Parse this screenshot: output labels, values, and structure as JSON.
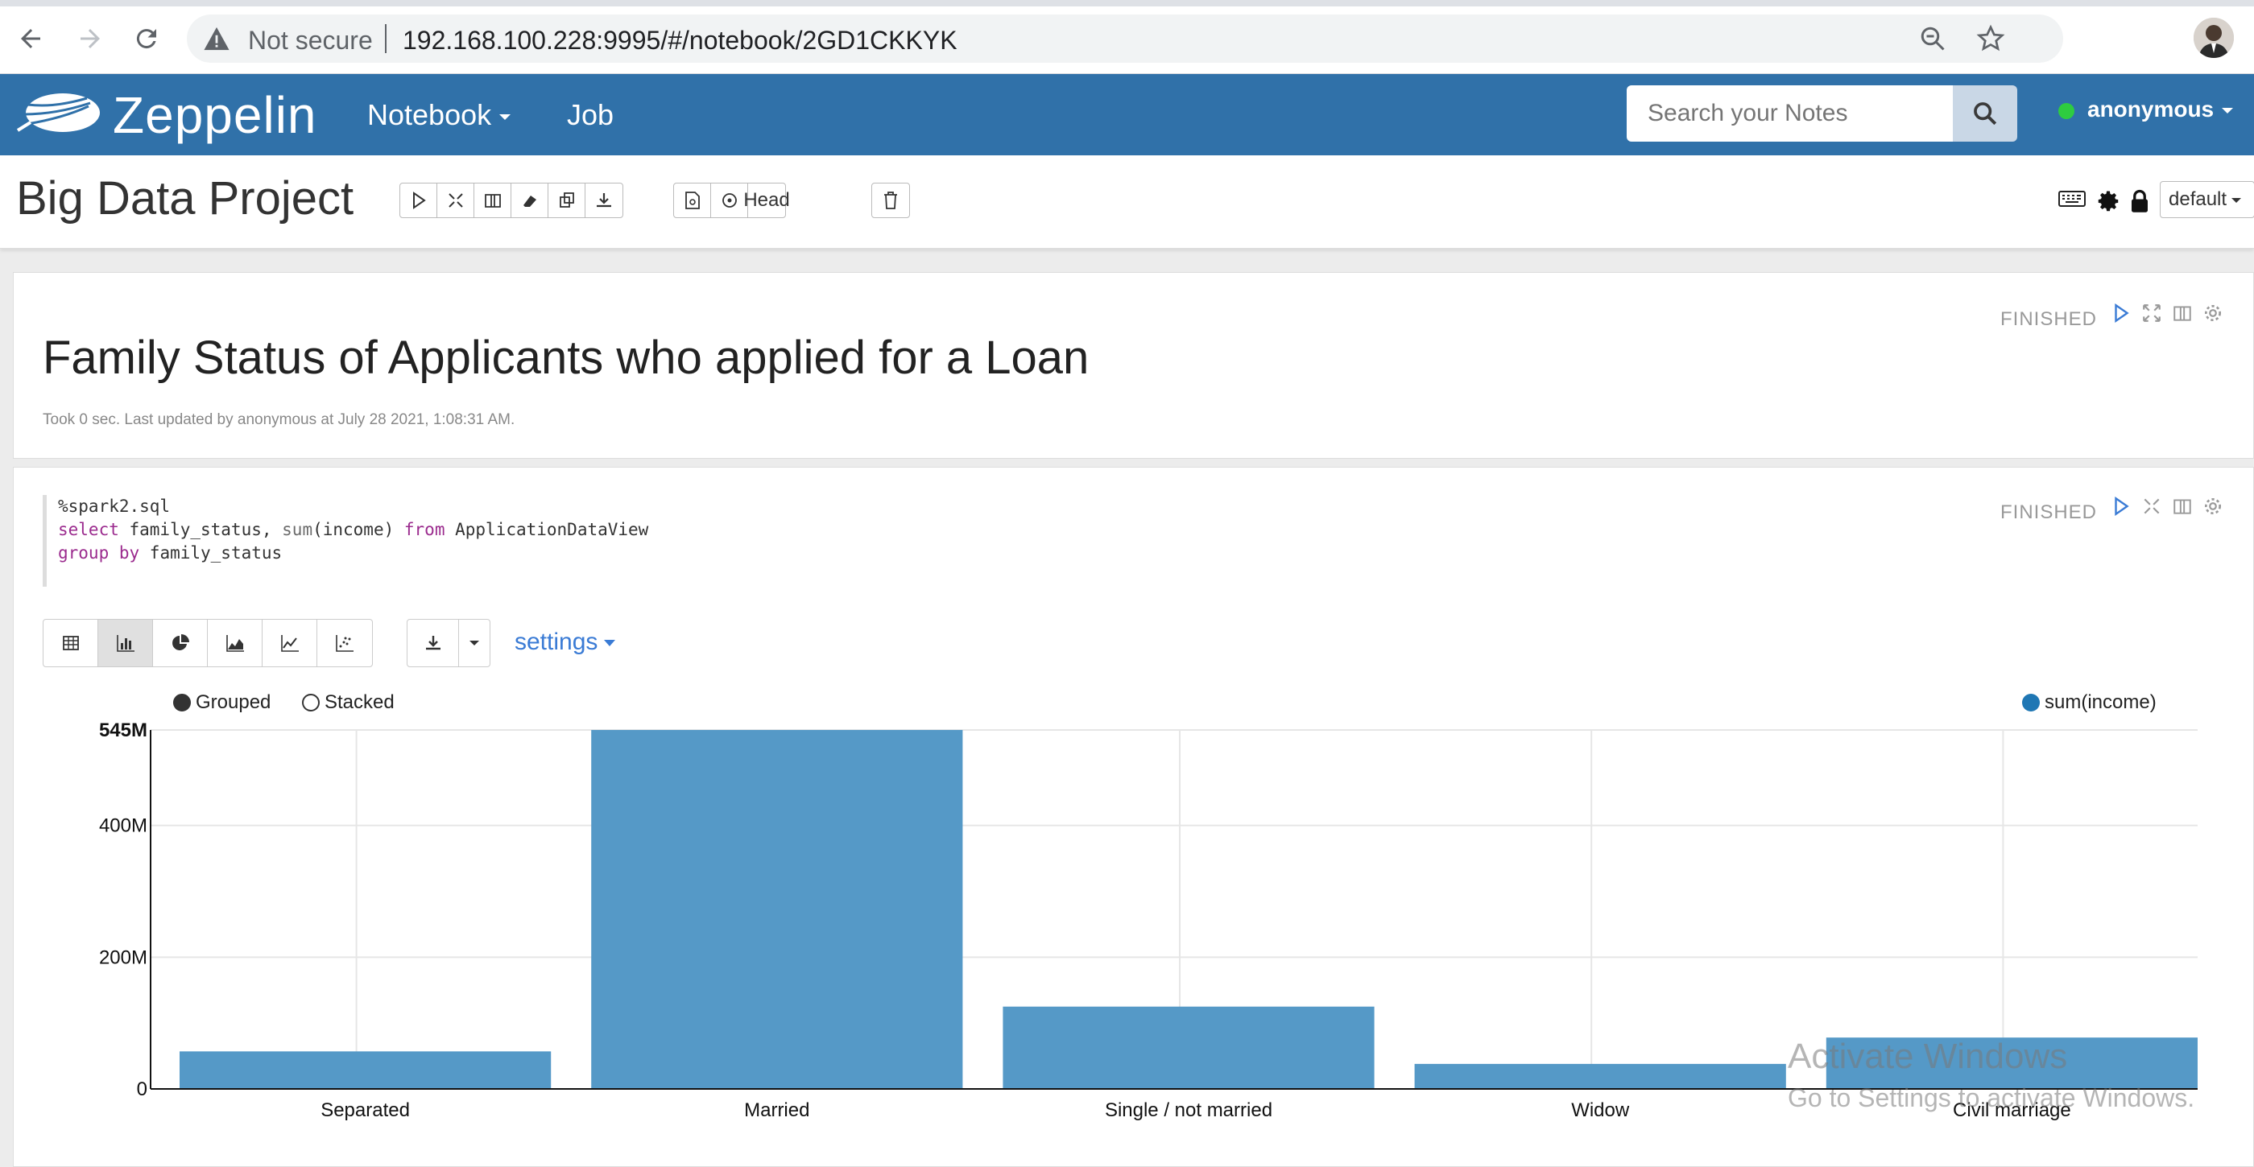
{
  "browser": {
    "security_label": "Not secure",
    "url": "192.168.100.228:9995/#/notebook/2GD1CKKYK"
  },
  "nav": {
    "brand": "Zeppelin",
    "notebook_label": "Notebook",
    "job_label": "Job",
    "search_placeholder": "Search your Notes",
    "user": "anonymous"
  },
  "note": {
    "title": "Big Data Project",
    "head_label": "Head",
    "interpreter_binding": "default"
  },
  "paragraph1": {
    "status": "FINISHED",
    "heading": "Family Status of Applicants who applied for a Loan",
    "meta": "Took 0 sec. Last updated by anonymous at July 28 2021, 1:08:31 AM."
  },
  "paragraph2": {
    "status": "FINISHED",
    "code": {
      "line1": "%spark2.sql",
      "line2_kw1": "select",
      "line2_a": " family_status, ",
      "line2_fn": "sum",
      "line2_b": "(income) ",
      "line2_kw2": "from",
      "line2_c": " ApplicationDataView",
      "line3_kw": "group by",
      "line3_a": " family_status"
    },
    "settings_label": "settings",
    "grouped_label": "Grouped",
    "stacked_label": "Stacked"
  },
  "chart_data": {
    "type": "bar",
    "categories": [
      "Separated",
      "Married",
      "Single / not married",
      "Widow",
      "Civil marriage"
    ],
    "series": [
      {
        "name": "sum(income)",
        "values": [
          57000000,
          545000000,
          125000000,
          38000000,
          78000000
        ]
      }
    ],
    "yticks": [
      "0",
      "200M",
      "400M",
      "545M"
    ],
    "ytick_values": [
      0,
      200000000,
      400000000,
      545000000
    ],
    "ylim": [
      0,
      545000000
    ],
    "grid": true,
    "legend": "top-right",
    "bar_color": "#5599c7"
  },
  "watermark": {
    "line1": "Activate Windows",
    "line2": "Go to Settings to activate Windows."
  }
}
